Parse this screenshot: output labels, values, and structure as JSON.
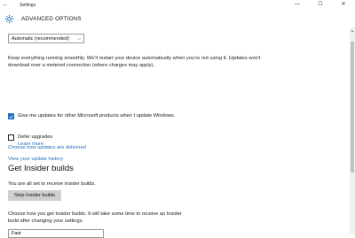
{
  "window": {
    "back_glyph": "←",
    "title": "Settings",
    "controls": {
      "minimize": "—",
      "maximize": "☐",
      "close": "✕"
    }
  },
  "header": {
    "title": "ADVANCED OPTIONS",
    "icon": "gear-icon"
  },
  "update_mode": {
    "selected": "Automatic (recommended)"
  },
  "description": "Keep everything running smoothly. We’ll restart your device automatically when you’re not using it. Updates won’t download over a metered connection (where charges may apply).",
  "options": [
    {
      "label": "Give me updates for other Microsoft products when I update Windows.",
      "checked": true
    },
    {
      "label": "Defer upgrades",
      "checked": false
    }
  ],
  "learn_more": "Learn more",
  "links": {
    "history": "View your update history",
    "delivery": "Choose how updates are delivered"
  },
  "insider": {
    "title": "Get Insider builds",
    "status": "You are all set to receive Insider builds.",
    "stop_button": "Stop Insider builds",
    "choose_text": "Choose how you get Insider builds. It will take some time to receive an Insider build after changing your settings.",
    "ring_selected": "Fast"
  },
  "colors": {
    "accent": "#1f6fbf",
    "button": "#cfcfcf"
  }
}
